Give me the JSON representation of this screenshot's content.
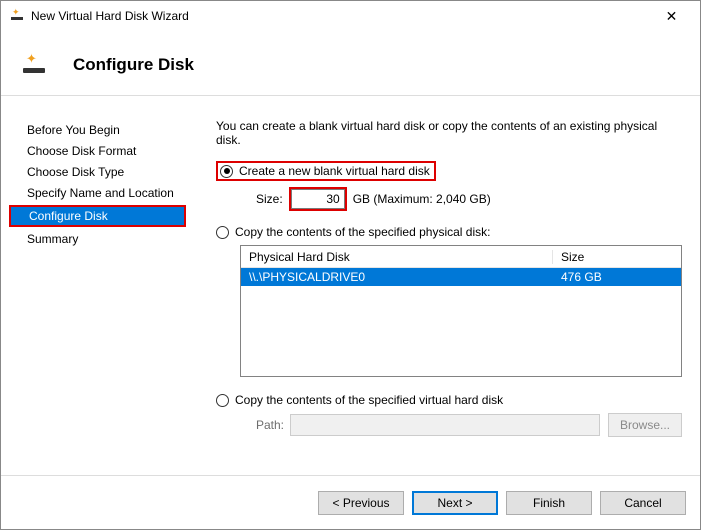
{
  "window": {
    "title": "New Virtual Hard Disk Wizard"
  },
  "header": {
    "title": "Configure Disk"
  },
  "nav": {
    "items": [
      {
        "label": "Before You Begin"
      },
      {
        "label": "Choose Disk Format"
      },
      {
        "label": "Choose Disk Type"
      },
      {
        "label": "Specify Name and Location"
      },
      {
        "label": "Configure Disk"
      },
      {
        "label": "Summary"
      }
    ]
  },
  "content": {
    "intro": "You can create a blank virtual hard disk or copy the contents of an existing physical disk.",
    "opt_blank": {
      "label": "Create a new blank virtual hard disk"
    },
    "size": {
      "label": "Size:",
      "value": "30",
      "unit": "GB (Maximum: 2,040 GB)"
    },
    "opt_copy_phys": {
      "label": "Copy the contents of the specified physical disk:"
    },
    "table": {
      "col1": "Physical Hard Disk",
      "col2": "Size",
      "rows": [
        {
          "disk": "\\\\.\\PHYSICALDRIVE0",
          "size": "476 GB"
        }
      ]
    },
    "opt_copy_vhd": {
      "label": "Copy the contents of the specified virtual hard disk"
    },
    "path": {
      "label": "Path:",
      "value": ""
    },
    "browse": "Browse..."
  },
  "footer": {
    "previous": "< Previous",
    "next": "Next >",
    "finish": "Finish",
    "cancel": "Cancel"
  }
}
